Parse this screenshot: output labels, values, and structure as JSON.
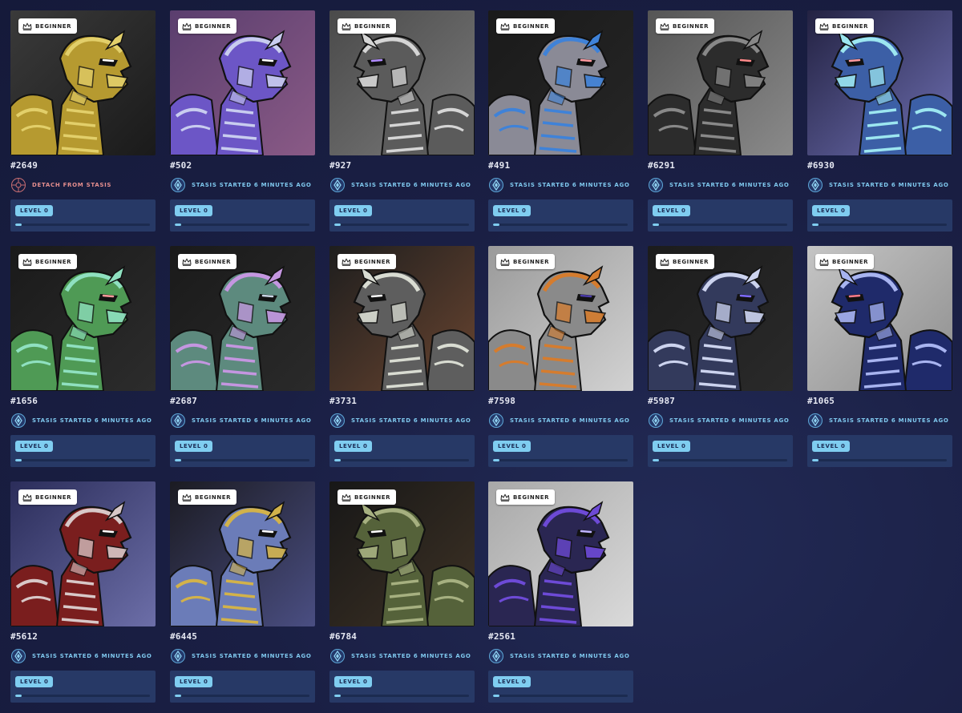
{
  "labels": {
    "tier": "Beginner",
    "level": "Level 0"
  },
  "colors": {
    "accent": "#7fcdf0",
    "stasis_text": "#7fc8ee",
    "detach_text": "#e58e8e"
  },
  "cards": [
    {
      "id": "#2649",
      "status": "Detach from stasis",
      "state": "detach",
      "level_progress": 0.05,
      "bg": [
        "#3a3a3a",
        "#1a1a1a"
      ],
      "main": "#b69a30",
      "accent": "#e2cf6a",
      "eye": "#ffffff"
    },
    {
      "id": "#502",
      "status": "Stasis started 6 minutes ago",
      "state": "stasis",
      "level_progress": 0.05,
      "bg": [
        "#5a3e6e",
        "#8a5a86"
      ],
      "main": "#6c56c6",
      "accent": "#c8ccef",
      "eye": "#ffffff"
    },
    {
      "id": "#927",
      "status": "Stasis started 6 minutes ago",
      "state": "stasis",
      "level_progress": 0.05,
      "bg": [
        "#4a4a4a",
        "#7a7a7a"
      ],
      "main": "#5b5b5b",
      "accent": "#d5d5d5",
      "eye": "#b28cff"
    },
    {
      "id": "#491",
      "status": "Stasis started 6 minutes ago",
      "state": "stasis",
      "level_progress": 0.05,
      "bg": [
        "#1a1a1a",
        "#262626"
      ],
      "main": "#8a8a96",
      "accent": "#3f82d8",
      "eye": "#ff9aa0"
    },
    {
      "id": "#6291",
      "status": "Stasis started 6 minutes ago",
      "state": "stasis",
      "level_progress": 0.05,
      "bg": [
        "#555555",
        "#8a8a8a"
      ],
      "main": "#2c2c2c",
      "accent": "#888888",
      "eye": "#ff8a8a"
    },
    {
      "id": "#6930",
      "status": "Stasis started 6 minutes ago",
      "state": "stasis",
      "level_progress": 0.05,
      "bg": [
        "#232242",
        "#6e6fb2"
      ],
      "main": "#3c5fa6",
      "accent": "#9ce6f0",
      "eye": "#ff9aa0"
    },
    {
      "id": "#1656",
      "status": "Stasis started 6 minutes ago",
      "state": "stasis",
      "level_progress": 0.05,
      "bg": [
        "#1a1a1a",
        "#2c2c2c"
      ],
      "main": "#4f9a55",
      "accent": "#8fe0c0",
      "eye": "#ff9a9a"
    },
    {
      "id": "#2687",
      "status": "Stasis started 6 minutes ago",
      "state": "stasis",
      "level_progress": 0.05,
      "bg": [
        "#1a1a1a",
        "#2a2a2a"
      ],
      "main": "#5d8a7e",
      "accent": "#c496e0",
      "eye": "#c8d4e2"
    },
    {
      "id": "#3731",
      "status": "Stasis started 6 minutes ago",
      "state": "stasis",
      "level_progress": 0.05,
      "bg": [
        "#1e1e1e",
        "#6a4530"
      ],
      "main": "#5e5e5e",
      "accent": "#d9dcd2",
      "eye": "#ffffff"
    },
    {
      "id": "#7598",
      "status": "Stasis started 6 minutes ago",
      "state": "stasis",
      "level_progress": 0.05,
      "bg": [
        "#9a9a9a",
        "#d2d2d2"
      ],
      "main": "#8a8a8a",
      "accent": "#d57c2e",
      "eye": "#4a3aa8"
    },
    {
      "id": "#5987",
      "status": "Stasis started 6 minutes ago",
      "state": "stasis",
      "level_progress": 0.05,
      "bg": [
        "#1c1c1c",
        "#2a2a2a"
      ],
      "main": "#333a5c",
      "accent": "#ccd3ee",
      "eye": "#7e6bff"
    },
    {
      "id": "#1065",
      "status": "Stasis started 6 minutes ago",
      "state": "stasis",
      "level_progress": 0.05,
      "bg": [
        "#c5c5c5",
        "#8d8d8d"
      ],
      "main": "#1f2a6a",
      "accent": "#a8b4f0",
      "eye": "#ff7b8a"
    },
    {
      "id": "#5612",
      "status": "Stasis started 6 minutes ago",
      "state": "stasis",
      "level_progress": 0.05,
      "bg": [
        "#2b2d5a",
        "#6c6ea8"
      ],
      "main": "#7a1e1e",
      "accent": "#d8c8c8",
      "eye": "#ffffff"
    },
    {
      "id": "#6445",
      "status": "Stasis started 6 minutes ago",
      "state": "stasis",
      "level_progress": 0.05,
      "bg": [
        "#1b1b22",
        "#4a4e82"
      ],
      "main": "#6b7cb8",
      "accent": "#d2b24a",
      "eye": "#ffffff"
    },
    {
      "id": "#6784",
      "status": "Stasis started 6 minutes ago",
      "state": "stasis",
      "level_progress": 0.05,
      "bg": [
        "#171717",
        "#3e3225"
      ],
      "main": "#55623a",
      "accent": "#a6b080",
      "eye": "#ffffff"
    },
    {
      "id": "#2561",
      "status": "Stasis started 6 minutes ago",
      "state": "stasis",
      "level_progress": 0.05,
      "bg": [
        "#a8a8a8",
        "#dadada"
      ],
      "main": "#2a2652",
      "accent": "#6d4ad6",
      "eye": "#c0b4ff"
    }
  ]
}
